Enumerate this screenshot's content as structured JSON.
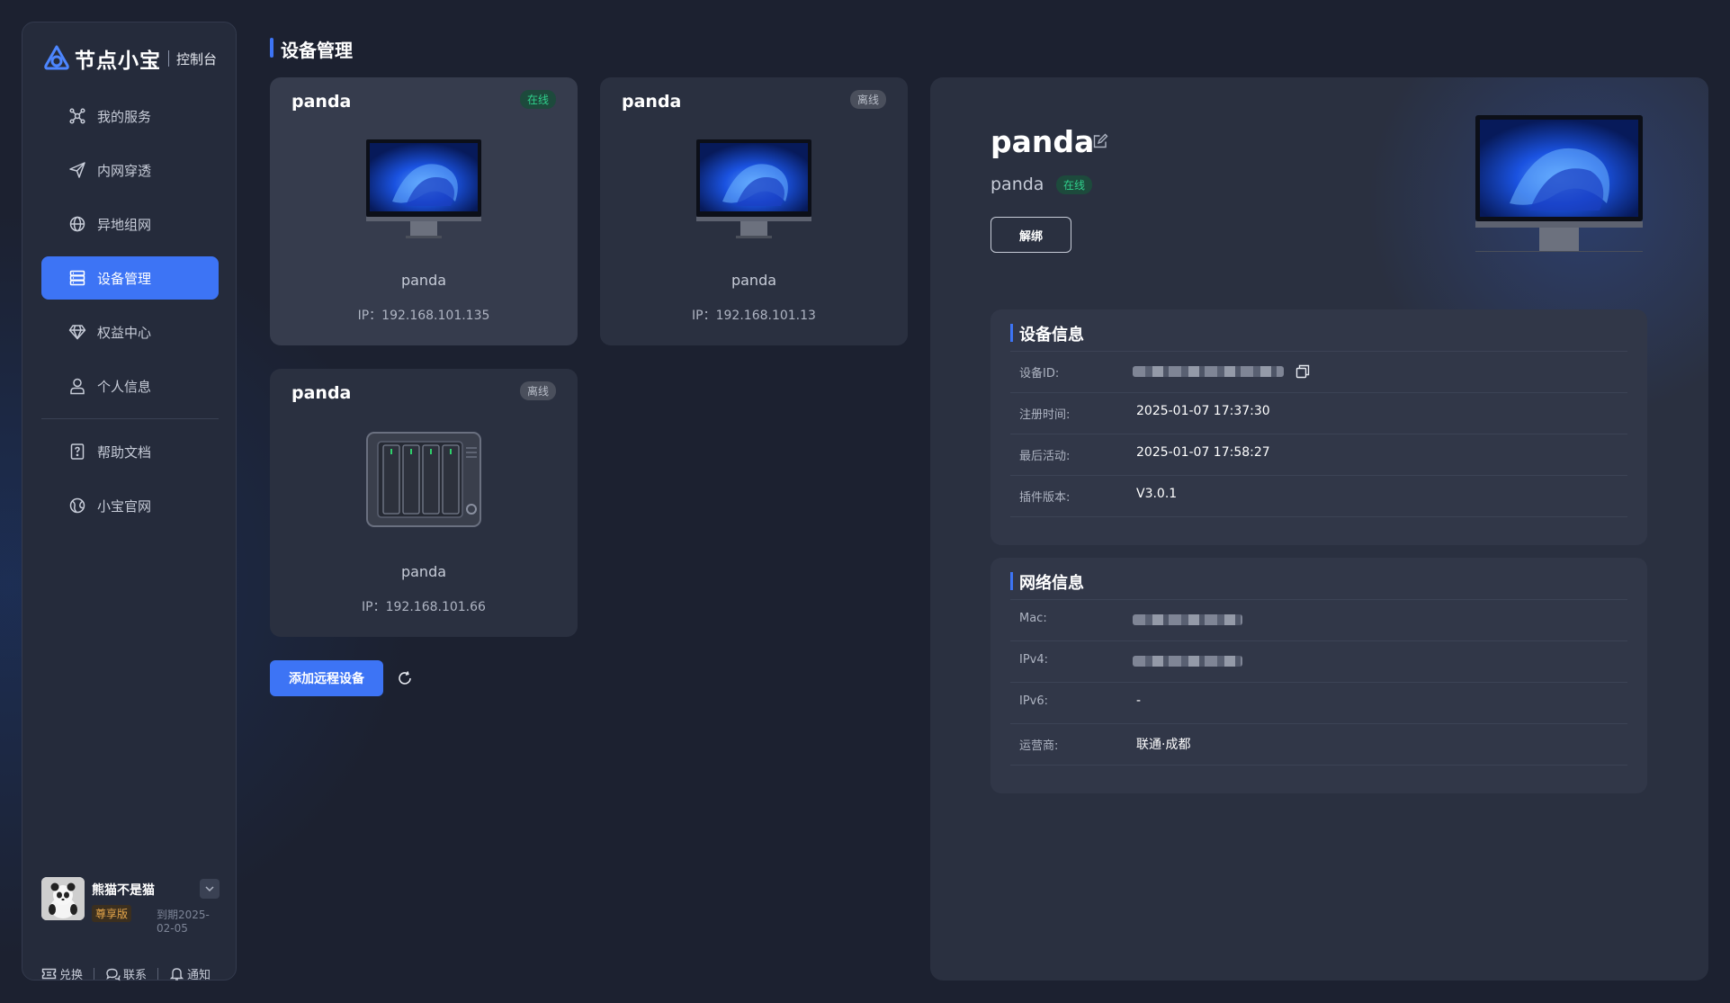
{
  "app": {
    "logo_text": "节点小宝",
    "logo_sub": "控制台"
  },
  "sidebar": {
    "items": [
      {
        "label": "我的服务",
        "icon": "services-icon"
      },
      {
        "label": "内网穿透",
        "icon": "send-icon"
      },
      {
        "label": "异地组网",
        "icon": "network-icon"
      },
      {
        "label": "设备管理",
        "icon": "device-icon",
        "active": true
      },
      {
        "label": "权益中心",
        "icon": "diamond-icon"
      },
      {
        "label": "个人信息",
        "icon": "user-icon"
      },
      {
        "label": "帮助文档",
        "icon": "help-doc-icon"
      },
      {
        "label": "小宝官网",
        "icon": "globe-icon"
      }
    ]
  },
  "user": {
    "name": "熊猫不是猫",
    "badge": "尊享版",
    "expiry": "到期2025-02-05",
    "footer": {
      "redeem": "兑换",
      "contact": "联系",
      "notify": "通知"
    }
  },
  "page": {
    "title": "设备管理"
  },
  "devices": [
    {
      "title": "panda",
      "status": "在线",
      "online": true,
      "name": "panda",
      "ip": "IP：192.168.101.135",
      "type": "monitor"
    },
    {
      "title": "panda",
      "status": "离线",
      "online": false,
      "name": "panda",
      "ip": "IP：192.168.101.13",
      "type": "monitor"
    },
    {
      "title": "panda",
      "status": "离线",
      "online": false,
      "name": "panda",
      "ip": "IP：192.168.101.66",
      "type": "nas"
    }
  ],
  "actions": {
    "add_remote": "添加远程设备"
  },
  "detail": {
    "name": "panda",
    "sub": "panda",
    "status": "在线",
    "unbind": "解绑",
    "device_info": {
      "title": "设备信息",
      "rows": [
        {
          "key": "设备ID:",
          "value": "",
          "masked": true
        },
        {
          "key": "注册时间:",
          "value": "2025-01-07 17:37:30"
        },
        {
          "key": "最后活动:",
          "value": "2025-01-07 17:58:27"
        },
        {
          "key": "插件版本:",
          "value": "V3.0.1"
        }
      ]
    },
    "network_info": {
      "title": "网络信息",
      "rows": [
        {
          "key": "Mac:",
          "value": "",
          "masked": true
        },
        {
          "key": "IPv4:",
          "value": "",
          "masked": true
        },
        {
          "key": "IPv6:",
          "value": "-"
        },
        {
          "key": "运营商:",
          "value": "联通·成都"
        }
      ]
    }
  },
  "colors": {
    "accent": "#3d74f5",
    "online": "#2fcf8b",
    "background": "#1c2130",
    "card": "#2a3040"
  }
}
